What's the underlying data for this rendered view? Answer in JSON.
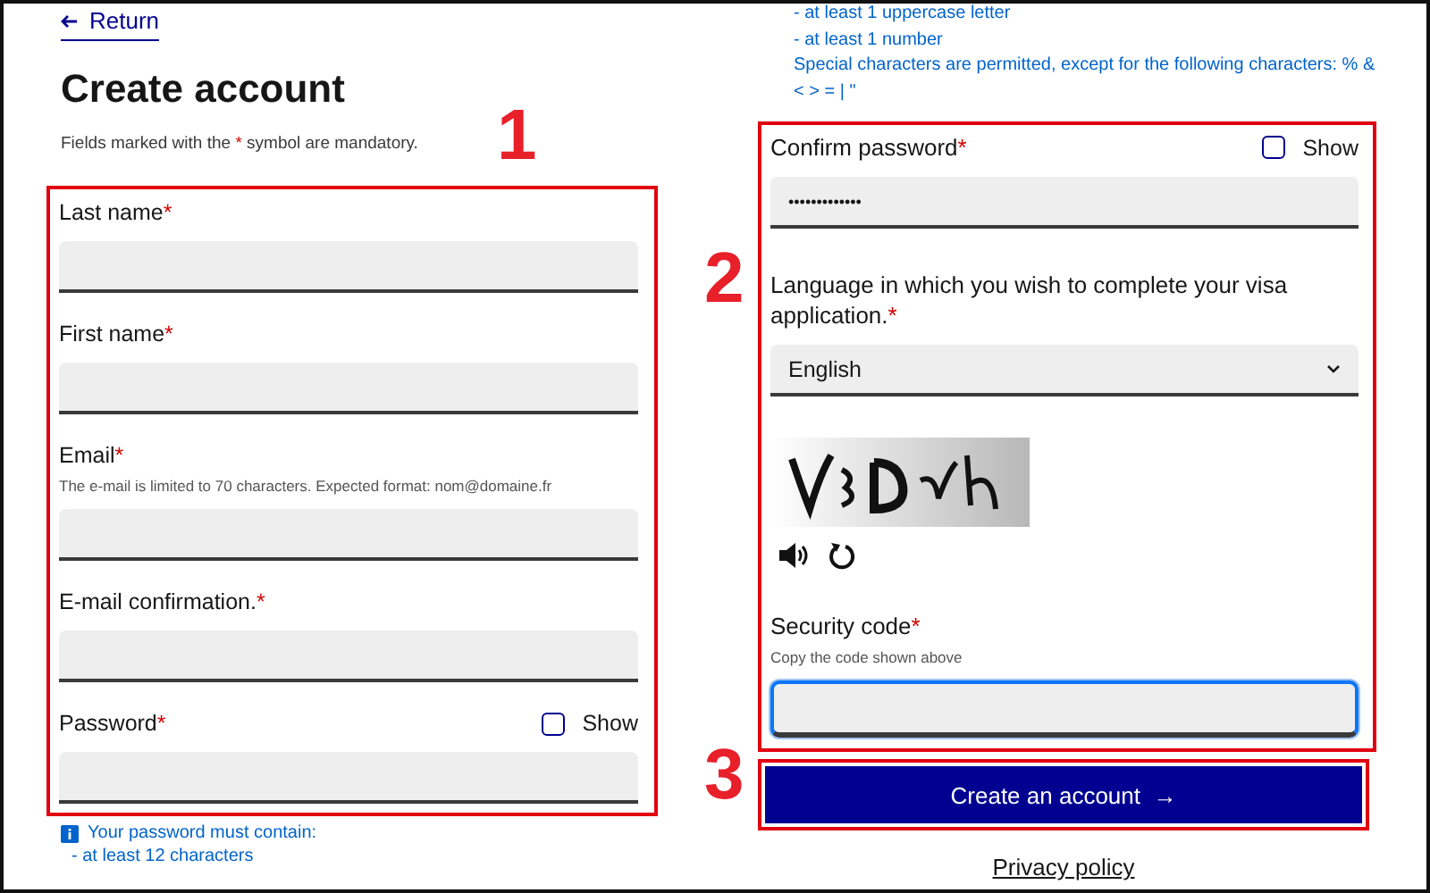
{
  "return_link": {
    "label": "Return"
  },
  "title": "Create account",
  "mandatory_note": {
    "before": "Fields marked with the ",
    "marker": "*",
    "after": " symbol are mandatory."
  },
  "left_fields": [
    {
      "label": "Last name",
      "marker": "*"
    },
    {
      "label": "First name",
      "marker": "*"
    },
    {
      "label": "Email",
      "marker": "*",
      "hint": "The e-mail is limited to 70 characters. Expected format: nom@domaine.fr"
    },
    {
      "label": "E-mail confirmation.",
      "marker": "*"
    },
    {
      "label": "Password",
      "marker": "*",
      "show": {
        "label": "Show",
        "checked": false
      }
    }
  ],
  "password_rules": {
    "heading": "Your password must contain:",
    "items": [
      "- at least 12 characters"
    ]
  },
  "rules_continued": [
    "- at least 1 uppercase letter",
    "- at least 1 number",
    "Special characters are permitted, except for the following characters: % & < > = | \""
  ],
  "right_fields": [
    {
      "kind": "password",
      "label": "Confirm password",
      "marker": "*",
      "value": "•••••••••••••",
      "show": {
        "label": "Show",
        "checked": false
      }
    },
    {
      "kind": "select",
      "label": "Language in which you wish to complete your visa application.",
      "marker": "*",
      "value": "English"
    },
    {
      "kind": "captcha"
    },
    {
      "kind": "text",
      "label": "Security code",
      "marker": "*",
      "hint": "Copy the code shown above",
      "focused": true
    }
  ],
  "submit": {
    "label": "Create an account",
    "arrow": "→"
  },
  "privacy_link": {
    "label": "Privacy policy"
  },
  "annotations": [
    {
      "label": "1"
    },
    {
      "label": "2"
    },
    {
      "label": "3"
    }
  ]
}
